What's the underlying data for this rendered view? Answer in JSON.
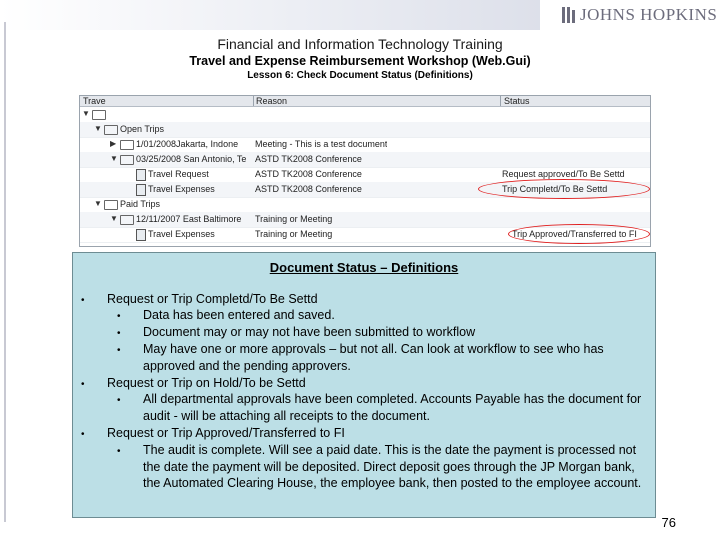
{
  "header": {
    "brand": "JOHNS HOPKINS",
    "title": "Financial and Information Technology Training",
    "subtitle": "Travel and Expense Reimbursement Workshop (Web.Gui)",
    "lesson": "Lesson 6: Check Document Status (Definitions)"
  },
  "tree": {
    "columns": [
      "Trave",
      "Reason",
      "Status"
    ],
    "rows": [
      {
        "name": "",
        "reason": "",
        "status": ""
      },
      {
        "name": "Open Trips",
        "reason": "",
        "status": ""
      },
      {
        "name": "1/01/2008Jakarta, Indone",
        "reason": "Meeting - This is a test document",
        "status": ""
      },
      {
        "name": "03/25/2008 San Antonio, Te",
        "reason": "ASTD TK2008 Conference",
        "status": ""
      },
      {
        "name": "Travel Request",
        "reason": "ASTD TK2008 Conference",
        "status": "Request approved/To Be Settd"
      },
      {
        "name": "Travel Expenses",
        "reason": "ASTD TK2008 Conference",
        "status": "Trip Completd/To Be Settd"
      },
      {
        "name": "Paid Trips",
        "reason": "",
        "status": ""
      },
      {
        "name": "12/11/2007 East Baltimore",
        "reason": "Training or Meeting",
        "status": ""
      },
      {
        "name": "Travel Expenses",
        "reason": "Training or Meeting",
        "status": "Trip Approved/Transferred to FI"
      }
    ]
  },
  "definitions": {
    "title": "Document Status – Definitions",
    "sections": [
      {
        "heading": "Request or Trip Completd/To Be Settd",
        "points": [
          "Data has been entered and saved.",
          "Document may or may not have been submitted to workflow",
          "May have one or more approvals – but not all.  Can look at workflow to see who has approved and the pending approvers."
        ]
      },
      {
        "heading": "Request or Trip on Hold/To be Settd",
        "points": [
          "All departmental approvals have been completed.  Accounts Payable has the document for audit -  will be attaching all receipts to the document."
        ]
      },
      {
        "heading": "Request or Trip Approved/Transferred to FI",
        "points": [
          "The audit is complete.  Will see a paid date. This is the date the payment is processed not the date the payment will be deposited.  Direct deposit goes through the JP Morgan bank, the Automated Clearing House, the employee bank, then posted to the employee account."
        ]
      }
    ]
  },
  "page_number": "76"
}
